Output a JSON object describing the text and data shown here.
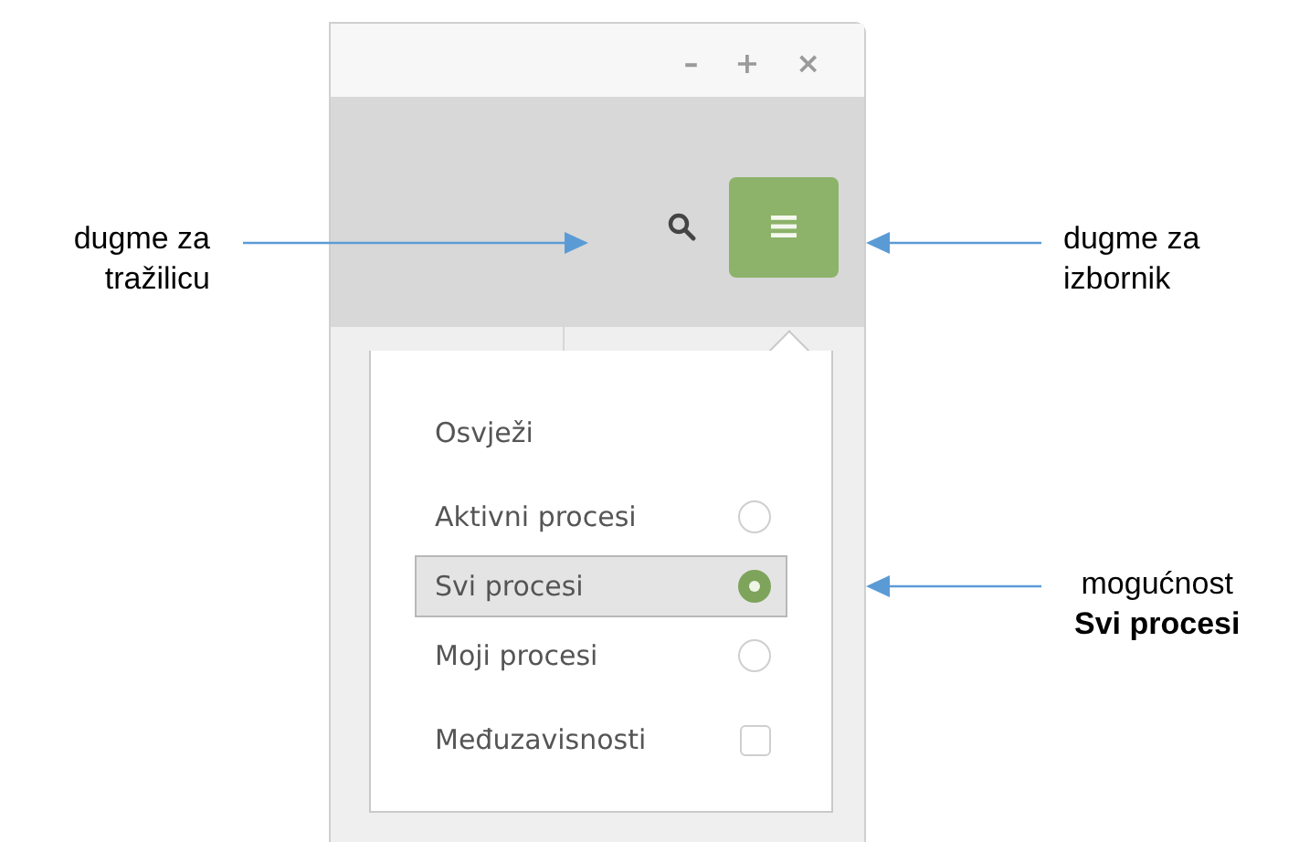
{
  "window": {
    "controls": [
      "–",
      "+",
      "×"
    ]
  },
  "menu": {
    "items": [
      {
        "kind": "action",
        "label": "Osvježi"
      },
      {
        "kind": "radio",
        "label": "Aktivni procesi",
        "selected": false
      },
      {
        "kind": "radio",
        "label": "Svi procesi",
        "selected": true
      },
      {
        "kind": "radio",
        "label": "Moji procesi",
        "selected": false
      },
      {
        "kind": "checkbox",
        "label": "Međuzavisnosti",
        "checked": false
      }
    ]
  },
  "annotations": [
    {
      "kind": "left",
      "lines": [
        "dugme za",
        "tražilicu"
      ]
    },
    {
      "kind": "right",
      "lines": [
        "dugme za",
        "izbornik"
      ]
    },
    {
      "kind": "lower",
      "lines": [
        "mogućnost",
        "**Svi procesi**"
      ]
    }
  ]
}
